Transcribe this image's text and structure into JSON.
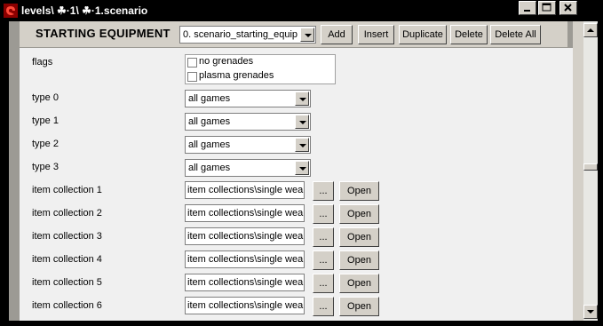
{
  "window": {
    "title": "levels\\ ☘·1\\ ☘·1.scenario",
    "minimize_label": "minimize",
    "maximize_label": "maximize",
    "close_label": "close"
  },
  "block": {
    "title": "STARTING EQUIPMENT",
    "selector_value": "0. scenario_starting_equip",
    "buttons": [
      "Add",
      "Insert",
      "Duplicate",
      "Delete",
      "Delete All"
    ]
  },
  "fields": {
    "flags_label": "flags",
    "flags": [
      {
        "label": "no grenades",
        "checked": false
      },
      {
        "label": "plasma grenades",
        "checked": false
      }
    ],
    "types": [
      {
        "label": "type 0",
        "value": "all games"
      },
      {
        "label": "type 1",
        "value": "all games"
      },
      {
        "label": "type 2",
        "value": "all games"
      },
      {
        "label": "type 3",
        "value": "all games"
      }
    ],
    "item_collections": [
      {
        "label": "item collection 1",
        "value": "item collections\\single wea",
        "browse": "...",
        "open": "Open"
      },
      {
        "label": "item collection 2",
        "value": "item collections\\single wea",
        "browse": "...",
        "open": "Open"
      },
      {
        "label": "item collection 3",
        "value": "item collections\\single wea",
        "browse": "...",
        "open": "Open"
      },
      {
        "label": "item collection 4",
        "value": "item collections\\single wea",
        "browse": "...",
        "open": "Open"
      },
      {
        "label": "item collection 5",
        "value": "item collections\\single wea",
        "browse": "...",
        "open": "Open"
      },
      {
        "label": "item collection 6",
        "value": "item collections\\single wea",
        "browse": "...",
        "open": "Open"
      }
    ]
  },
  "colors": {
    "frame": "#000000",
    "face": "#d4d0c8",
    "panel": "#f0f0f0",
    "stripe": "#9c9a94"
  }
}
